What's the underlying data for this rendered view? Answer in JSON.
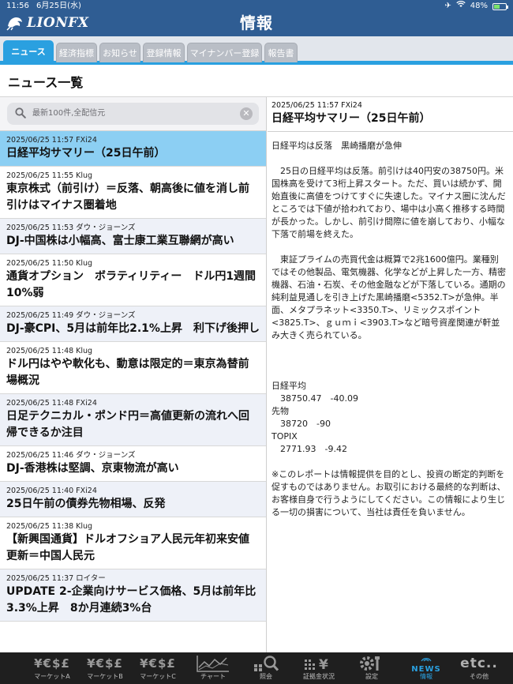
{
  "status": {
    "time": "11:56",
    "date": "6月25日(水)",
    "battery": "48%",
    "battery_level": 0.48
  },
  "header": {
    "logo_text": "LIONFX",
    "title": "情報"
  },
  "tabs": [
    {
      "label": "ニュース",
      "active": true
    },
    {
      "label": "経済指標",
      "active": false
    },
    {
      "label": "お知らせ",
      "active": false
    },
    {
      "label": "登録情報",
      "active": false
    },
    {
      "label": "マイナンバー登録",
      "active": false
    },
    {
      "label": "報告書",
      "active": false
    }
  ],
  "section_title": "ニュース一覧",
  "search": {
    "placeholder": "最新100件,全配信元"
  },
  "news": [
    {
      "meta": "2025/06/25 11:57 FXi24",
      "headline": "日経平均サマリー（25日午前）",
      "selected": true
    },
    {
      "meta": "2025/06/25 11:55 Klug",
      "headline": "東京株式（前引け）＝反落、朝高後に値を消し前引けはマイナス圏着地"
    },
    {
      "meta": "2025/06/25 11:53 ダウ・ジョーンズ",
      "headline": "DJ-中国株は小幅高、富士康工業互聯網が高い"
    },
    {
      "meta": "2025/06/25 11:50 Klug",
      "headline": "通貨オプション　ボラティリティー　ドル円1週間10%弱"
    },
    {
      "meta": "2025/06/25 11:49 ダウ・ジョーンズ",
      "headline": "DJ-豪CPI、5月は前年比2.1%上昇　利下げ後押し"
    },
    {
      "meta": "2025/06/25 11:48 Klug",
      "headline": "ドル円はやや軟化も、動意は限定的＝東京為替前場概況"
    },
    {
      "meta": "2025/06/25 11:48 FXi24",
      "headline": "日足テクニカル・ポンド円＝高値更新の流れへ回帰できるか注目"
    },
    {
      "meta": "2025/06/25 11:46 ダウ・ジョーンズ",
      "headline": "DJ-香港株は堅調、京東物流が高い"
    },
    {
      "meta": "2025/06/25 11:40 FXi24",
      "headline": "25日午前の債券先物相場、反発"
    },
    {
      "meta": "2025/06/25 11:38 Klug",
      "headline": "【新興国通貨】ドルオフショア人民元年初来安値更新＝中国人民元"
    },
    {
      "meta": "2025/06/25 11:37 ロイター",
      "headline": "UPDATE 2-企業向けサービス価格、5月は前年比3.3%上昇　8か月連続3%台"
    }
  ],
  "detail": {
    "meta": "2025/06/25 11:57 FXi24",
    "title": "日経平均サマリー（25日午前）",
    "body": "日経平均は反落　黒崎播磨が急伸\n\n　25日の日経平均は反落。前引けは40円安の38750円。米国株高を受けて3桁上昇スタート。ただ、買いは続かず、開始直後に高値をつけてすぐに失速した。マイナス圏に沈んだところでは下値が拾われており、場中は小高く推移する時間が長かった。しかし、前引け間際に値を崩しており、小幅な下落で前場を終えた。\n\n　東証プライムの売買代金は概算で2兆1600億円。業種別ではその他製品、電気機器、化学などが上昇した一方、精密機器、石油・石炭、その他金融などが下落している。通期の純利益見通しを引き上げた黒崎播磨<5352.T>が急伸。半面、メタプラネット<3350.T>、リミックスポイント<3825.T>、ｇｕｍｉ<3903.T>など暗号資産関連が軒並み大きく売られている。\n\n\n\n日経平均\n　38750.47　-40.09\n先物\n　38720　-90\nTOPIX\n　2771.93　-9.42\n\n※このレポートは情報提供を目的とし、投資の断定的判断を促すものではありません。お取引における最終的な判断は、お客様自身で行うようにしてください。この情報により生じる一切の損害について、当社は責任を負いません。"
  },
  "bottom_nav": [
    {
      "icon": "¥€$£",
      "label": "マーケットA"
    },
    {
      "icon": "¥€$£",
      "label": "マーケットB"
    },
    {
      "icon": "¥€$£",
      "label": "マーケットC"
    },
    {
      "icon": "chart-icon",
      "label": "チャート"
    },
    {
      "icon": "search-icon",
      "label": "照会"
    },
    {
      "icon": "yen-bars-icon",
      "label": "証拠金状況"
    },
    {
      "icon": "gear-wrench-icon",
      "label": "設定"
    },
    {
      "icon": "NEWS",
      "label": "情報",
      "active": true
    },
    {
      "icon": "etc..",
      "label": "その他"
    }
  ],
  "colors": {
    "header": "#2f5d93",
    "accent": "#2aa0e0",
    "selected_row": "#8ccff3",
    "alt_row": "#eef1f8",
    "bottom_bar": "#1f1f1f"
  }
}
